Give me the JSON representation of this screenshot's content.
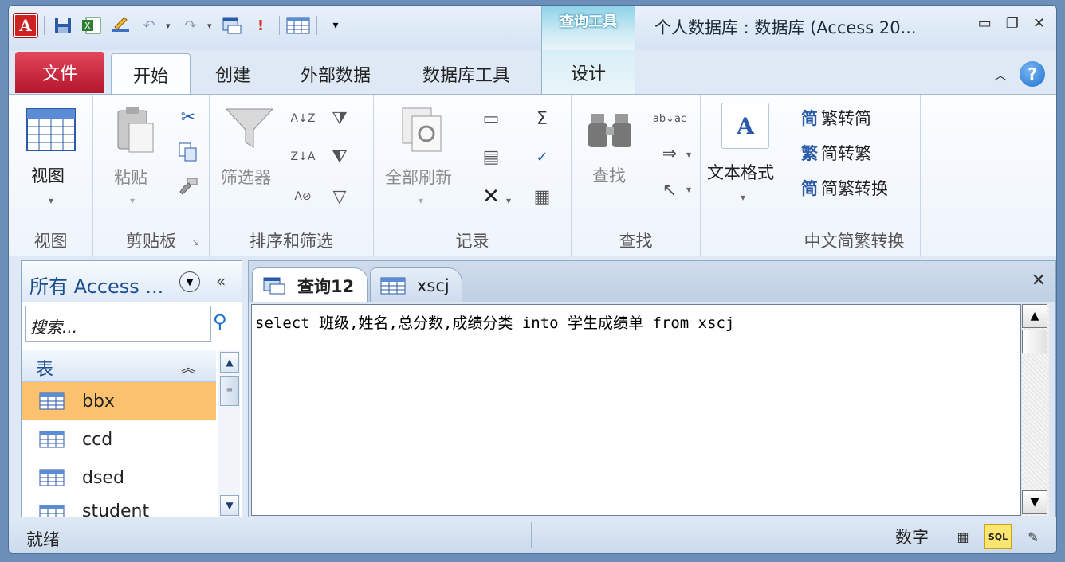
{
  "window": {
    "title": "个人数据库 : 数据库 (Access 20...",
    "context_tool_title": "查询工具"
  },
  "ribbon_tabs": {
    "file": "文件",
    "tabs": [
      "开始",
      "创建",
      "外部数据",
      "数据库工具"
    ],
    "context_tab": "设计",
    "active": "开始"
  },
  "ribbon": {
    "view": {
      "button": "视图",
      "group": "视图"
    },
    "clipboard": {
      "paste": "粘贴",
      "group": "剪贴板"
    },
    "sort_filter": {
      "filter": "筛选器",
      "group": "排序和筛选"
    },
    "records": {
      "refresh_all": "全部刷新",
      "group": "记录"
    },
    "find": {
      "find": "查找",
      "group": "查找"
    },
    "text_format": {
      "button": "文本格式",
      "group": ""
    },
    "chinese_conversion": {
      "trad_to_simp": "繁转简",
      "simp_to_trad": "简转繁",
      "convert": "简繁转换",
      "group": "中文简繁转换"
    }
  },
  "nav_pane": {
    "title": "所有 Access ...",
    "search_placeholder": "搜索...",
    "group_label": "表",
    "items": [
      {
        "label": "bbx",
        "selected": true
      },
      {
        "label": "ccd",
        "selected": false
      },
      {
        "label": "dsed",
        "selected": false
      },
      {
        "label": "student",
        "selected": false
      }
    ]
  },
  "doc_tabs": [
    {
      "label": "查询12",
      "active": true
    },
    {
      "label": "xscj",
      "active": false
    }
  ],
  "editor": {
    "sql": "select 班级,姓名,总分数,成绩分类 into 学生成绩单 from xscj"
  },
  "status": {
    "left": "就绪",
    "mode": "数字",
    "sql_label": "SQL"
  },
  "colors": {
    "file_tab": "#c8203a",
    "selected_row": "#fbc16e",
    "sql_button": "#fde572"
  }
}
